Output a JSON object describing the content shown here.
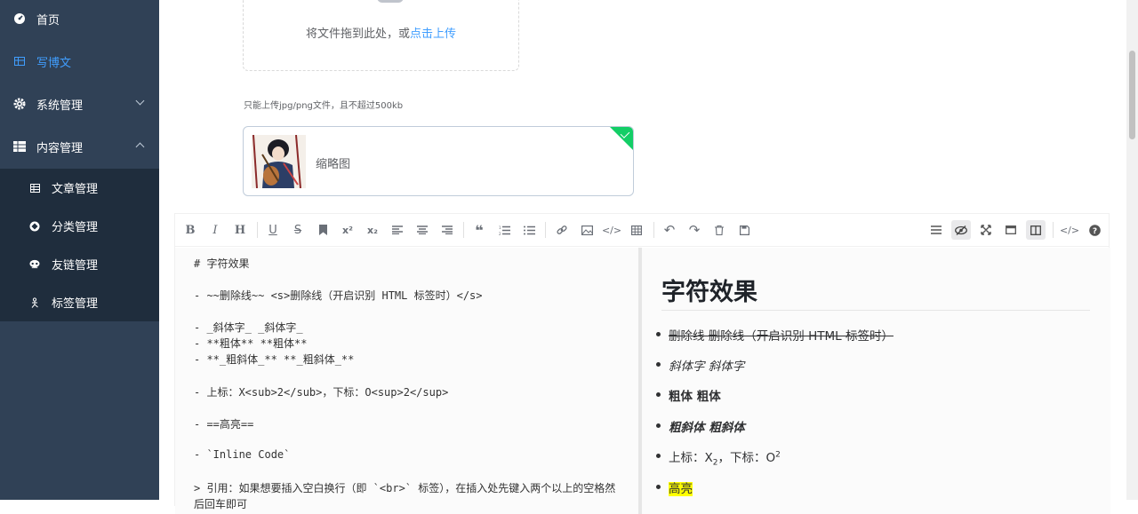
{
  "sidebar": {
    "items": [
      {
        "label": "首页",
        "icon": "dashboard-icon"
      },
      {
        "label": "写博文",
        "icon": "table-icon"
      },
      {
        "label": "系统管理",
        "icon": "gear-icon"
      },
      {
        "label": "内容管理",
        "icon": "grid-icon"
      }
    ],
    "subitems": [
      {
        "label": "文章管理",
        "icon": "table-icon"
      },
      {
        "label": "分类管理",
        "icon": "category-icon"
      },
      {
        "label": "友链管理",
        "icon": "link-icon"
      },
      {
        "label": "标签管理",
        "icon": "tag-icon"
      }
    ]
  },
  "upload": {
    "text": "将文件拖到此处，或",
    "link": "点击上传",
    "tip": "只能上传jpg/png文件，且不超过500kb",
    "file_name": "缩略图"
  },
  "editor": {
    "source_lines": [
      "# 字符效果",
      "- ~~删除线~~ <s>删除线（开启识别 HTML 标签时）</s>",
      "- _斜体字_ _斜体字_",
      "- **粗体** **粗体**",
      "- **_粗斜体_** **_粗斜体_**",
      "- 上标：X<sub>2</sub>，下标：O<sup>2</sup>",
      "- ==高亮==",
      "- `Inline Code`",
      "> 引用：如果想要插入空白换行（即 `<br>` 标签），在插入处先键入两个以上的空格然",
      "后回车即可"
    ],
    "preview": {
      "title": "字符效果",
      "strike": "删除线 删除线（开启识别 HTML 标签时）",
      "italic": "斜体字 斜体字",
      "bold": "粗体 粗体",
      "bold_italic": "粗斜体 粗斜体",
      "sub_prefix": "上标：X",
      "sub_val": "2",
      "sup_prefix": "，下标：O",
      "sup_val": "2",
      "highlight": "高亮"
    }
  },
  "colors": {
    "sidebar": "#304156",
    "submenu": "#1f2d3d",
    "accent": "#409EFF",
    "success": "#13ce66"
  }
}
